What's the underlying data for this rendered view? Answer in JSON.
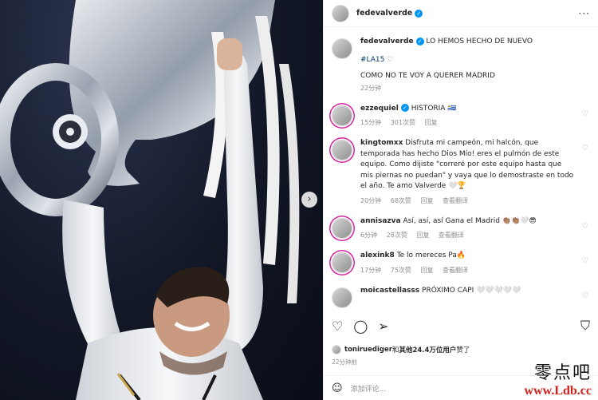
{
  "colors": {
    "accent": "#0095f6",
    "link": "#00376b",
    "muted": "#8e8e8e",
    "watermark_red": "#d0201a"
  },
  "header": {
    "username": "fedevalverde",
    "more_icon": "more-horizontal-icon"
  },
  "caption": {
    "username": "fedevalverde",
    "text": "LO HEMOS HECHO DE NUEVO",
    "hashtag": "#LA15",
    "line2": "COMO NO TE VOY A QUERER MADRID",
    "time": "22分钟"
  },
  "comments": [
    {
      "username": "ezzequiel",
      "text": "HISTORIA 🇺🇾",
      "time": "15分钟",
      "likes": "301次赞",
      "reply": "回复",
      "translate": ""
    },
    {
      "username": "kingtomxx",
      "text": "Disfruta mi campeón, mi halcón, que temporada has hecho Dios Mío! eres el pulmón de este equipo. Como dijiste \"correré por este equipo hasta que mis piernas no puedan\" y vaya que lo demostraste en todo el año. Te amo Valverde 🤍🏆",
      "time": "20分钟",
      "likes": "68次赞",
      "reply": "回复",
      "translate": "查看翻译"
    },
    {
      "username": "annisazva",
      "text": "Así, así, así Gana el Madrid 👏🏽👏🏽🤍😎",
      "time": "6分钟",
      "likes": "28次赞",
      "reply": "回复",
      "translate": "查看翻译"
    },
    {
      "username": "alexink8",
      "text": "Te lo mereces Pa🔥",
      "time": "17分钟",
      "likes": "75次赞",
      "reply": "回复",
      "translate": "查看翻译"
    },
    {
      "username": "moicastellasss",
      "text": "PRÓXIMO CAPI 🤍🤍🤍🤍🤍",
      "time": "",
      "likes": "",
      "reply": "",
      "translate": ""
    }
  ],
  "likes": {
    "user": "toniruediger",
    "mid": "和",
    "others": "其他24.4万位用户",
    "suffix": "赞了"
  },
  "post_time": "22分钟前",
  "add_comment": {
    "placeholder": "添加评论..."
  },
  "watermark": {
    "line1": "零点吧",
    "line2": "www.Ldb.cc"
  }
}
